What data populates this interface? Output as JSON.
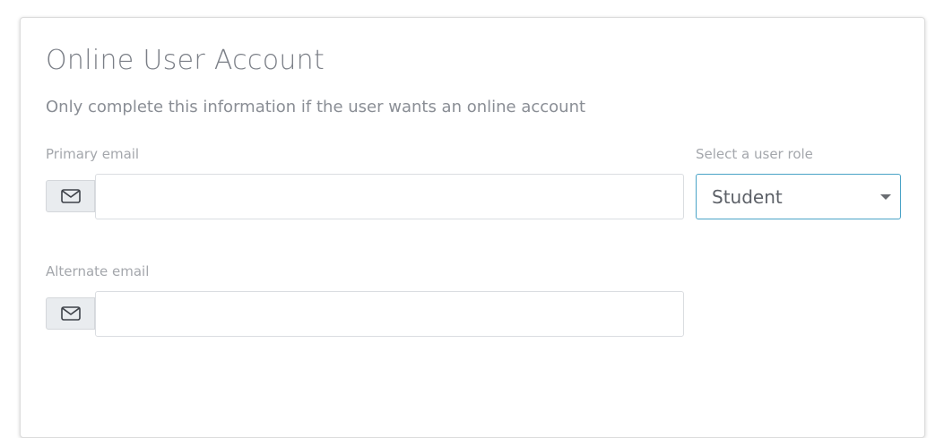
{
  "section": {
    "title": "Online User Account",
    "subtitle": "Only complete this information if the user wants an online account"
  },
  "primary_email": {
    "label": "Primary email",
    "value": "",
    "icon": "envelope-icon"
  },
  "user_role": {
    "label": "Select a user role",
    "selected": "Student"
  },
  "alternate_email": {
    "label": "Alternate email",
    "value": "",
    "icon": "envelope-icon"
  },
  "colors": {
    "select_focus_border": "#4aa3c7",
    "addon_background": "#e9ecef"
  }
}
